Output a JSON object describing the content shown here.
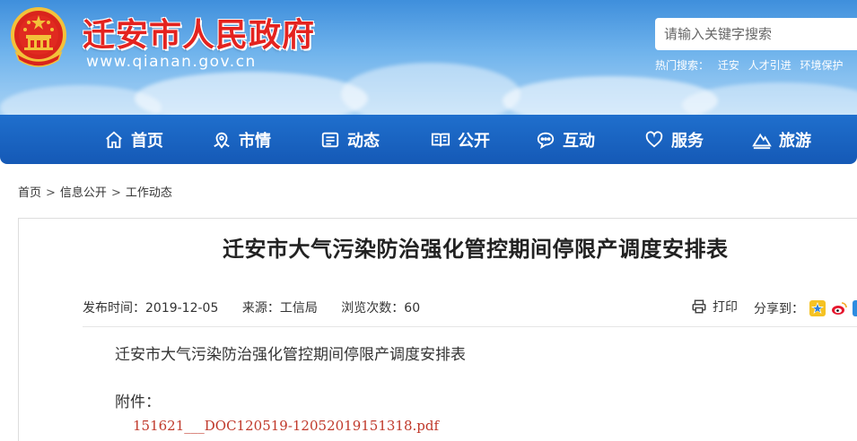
{
  "header": {
    "site_title": "迁安市人民政府",
    "site_domain": "www.qianan.gov.cn",
    "search_placeholder": "请输入关键字搜索",
    "hot_search_label": "热门搜索：",
    "hot_search_items": [
      "迁安",
      "人才引进",
      "环境保护"
    ]
  },
  "nav": {
    "items": [
      {
        "label": "首页",
        "icon": "home-icon"
      },
      {
        "label": "市情",
        "icon": "map-pin-icon"
      },
      {
        "label": "动态",
        "icon": "news-icon"
      },
      {
        "label": "公开",
        "icon": "book-icon"
      },
      {
        "label": "互动",
        "icon": "chat-icon"
      },
      {
        "label": "服务",
        "icon": "heart-icon"
      },
      {
        "label": "旅游",
        "icon": "mountain-icon"
      }
    ]
  },
  "breadcrumb": {
    "items": [
      "首页",
      "信息公开",
      "工作动态"
    ],
    "separator": ">"
  },
  "article": {
    "title": "迁安市大气污染防治强化管控期间停限产调度安排表",
    "publish_time": "发布时间：2019-12-05",
    "source": "来源：工信局",
    "views": "浏览次数：60",
    "print_label": "打印",
    "share_label": "分享到：",
    "content_title": "迁安市大气污染防治强化管控期间停限产调度安排表",
    "attachment_label": "附件：",
    "attachment_file": "151621___DOC120519-12052019151318.pdf"
  },
  "colors": {
    "title_red": "#e4231f",
    "nav_blue": "#1559b6",
    "link_red": "#c0392b"
  }
}
